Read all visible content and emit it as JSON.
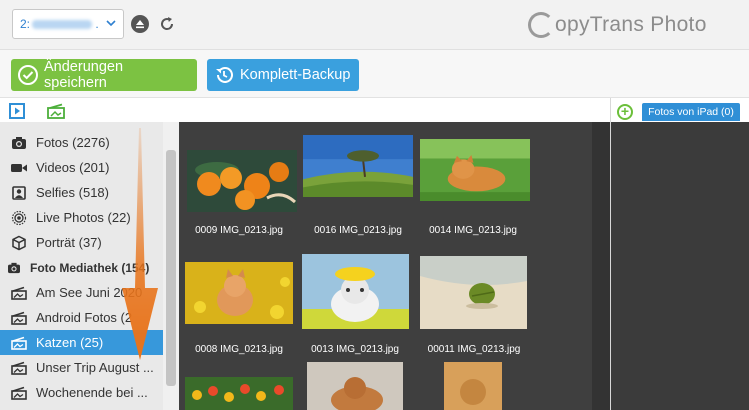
{
  "topbar": {
    "device_prefix": "2:",
    "device_suffix": ".",
    "logo_text": "opyTrans Photo"
  },
  "actions": {
    "save_label": "Änderungen speichern",
    "backup_label": "Komplett-Backup"
  },
  "right_panel": {
    "ipad_tab_label": "Fotos von iPad (0)"
  },
  "sidebar": {
    "items": [
      {
        "label": "Fotos (2276)",
        "icon": "camera-icon"
      },
      {
        "label": "Videos (201)",
        "icon": "video-icon"
      },
      {
        "label": "Selfies (518)",
        "icon": "selfie-icon"
      },
      {
        "label": "Live Photos (22)",
        "icon": "live-photo-icon"
      },
      {
        "label": "Porträt (37)",
        "icon": "cube-icon"
      },
      {
        "label": "Foto Mediathek (154)",
        "icon": "camera-icon"
      },
      {
        "label": "Am See Juni 2020",
        "icon": "album-icon"
      },
      {
        "label": "Android Fotos (2",
        "icon": "album-icon"
      },
      {
        "label": "Katzen (25)",
        "icon": "album-icon"
      },
      {
        "label": "Unser Trip August ...",
        "icon": "album-icon"
      },
      {
        "label": "Wochenende bei ...",
        "icon": "album-icon"
      }
    ]
  },
  "gallery": {
    "photos": [
      {
        "caption": "0009 IMG_0213.jpg"
      },
      {
        "caption": "0016 IMG_0213.jpg"
      },
      {
        "caption": "0014 IMG_0213.jpg"
      },
      {
        "caption": "0008 IMG_0213.jpg"
      },
      {
        "caption": "0013 IMG_0213.jpg"
      },
      {
        "caption": "00011 IMG_0213.jpg"
      }
    ]
  },
  "colors": {
    "accent_green": "#7cc242",
    "accent_blue": "#3aa0de",
    "selected": "#3798db",
    "gallery_bg": "#3f3f3f",
    "arrow": "#e8731a"
  }
}
